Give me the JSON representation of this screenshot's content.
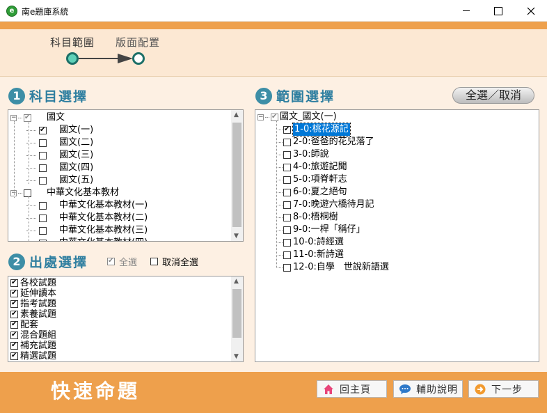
{
  "window": {
    "title": "南e題庫系統",
    "app_icon_glyph": "e"
  },
  "stepper": {
    "step1": "科目範圍",
    "step2": "版面配置"
  },
  "subject": {
    "number": "1",
    "title": "科目選擇",
    "tree": [
      {
        "label": "國文",
        "level": 0,
        "checked": false,
        "partial": true
      },
      {
        "label": "國文(一)",
        "level": 1,
        "checked": true
      },
      {
        "label": "國文(二)",
        "level": 1,
        "checked": false
      },
      {
        "label": "國文(三)",
        "level": 1,
        "checked": false
      },
      {
        "label": "國文(四)",
        "level": 1,
        "checked": false
      },
      {
        "label": "國文(五)",
        "level": 1,
        "checked": false
      },
      {
        "label": "中華文化基本教材",
        "level": 0,
        "checked": false
      },
      {
        "label": "中華文化基本教材(一)",
        "level": 1,
        "checked": false
      },
      {
        "label": "中華文化基本教材(二)",
        "level": 1,
        "checked": false
      },
      {
        "label": "中華文化基本教材(三)",
        "level": 1,
        "checked": false
      },
      {
        "label": "中華文化基本教材(四)",
        "level": 1,
        "checked": false
      }
    ]
  },
  "source": {
    "number": "2",
    "title": "出處選擇",
    "select_all": "全選",
    "select_all_checked": true,
    "deselect_all": "取消全選",
    "deselect_all_checked": false,
    "items": [
      "各校試題",
      "延伸讀本",
      "指考試題",
      "素養試題",
      "配套",
      "混合題組",
      "補充試題",
      "精選試題"
    ]
  },
  "range": {
    "number": "3",
    "title": "範圍選擇",
    "toggle_button": "全選／取消",
    "root": "國文_國文(一)",
    "items": [
      {
        "label": "1-0:桃花源記",
        "checked": true,
        "selected": true
      },
      {
        "label": "2-0:爸爸的花兒落了",
        "checked": false
      },
      {
        "label": "3-0:師說",
        "checked": false
      },
      {
        "label": "4-0:旅遊記聞",
        "checked": false
      },
      {
        "label": "5-0:項脊軒志",
        "checked": false
      },
      {
        "label": "6-0:夏之絕句",
        "checked": false
      },
      {
        "label": "7-0:晚遊六橋待月記",
        "checked": false
      },
      {
        "label": "8-0:梧桐樹",
        "checked": false
      },
      {
        "label": "9-0:一桿「稱仔」",
        "checked": false
      },
      {
        "label": "10-0:詩經選",
        "checked": false
      },
      {
        "label": "11-0:新詩選",
        "checked": false
      },
      {
        "label": "12-0:自學　世說新語選",
        "checked": false
      }
    ]
  },
  "footer": {
    "brand": "快速命題",
    "home": "回主頁",
    "help": "輔助說明",
    "next": "下一步"
  },
  "colors": {
    "orange": "#eea04c",
    "teal": "#3d8ea6",
    "selection": "#0078d7"
  }
}
